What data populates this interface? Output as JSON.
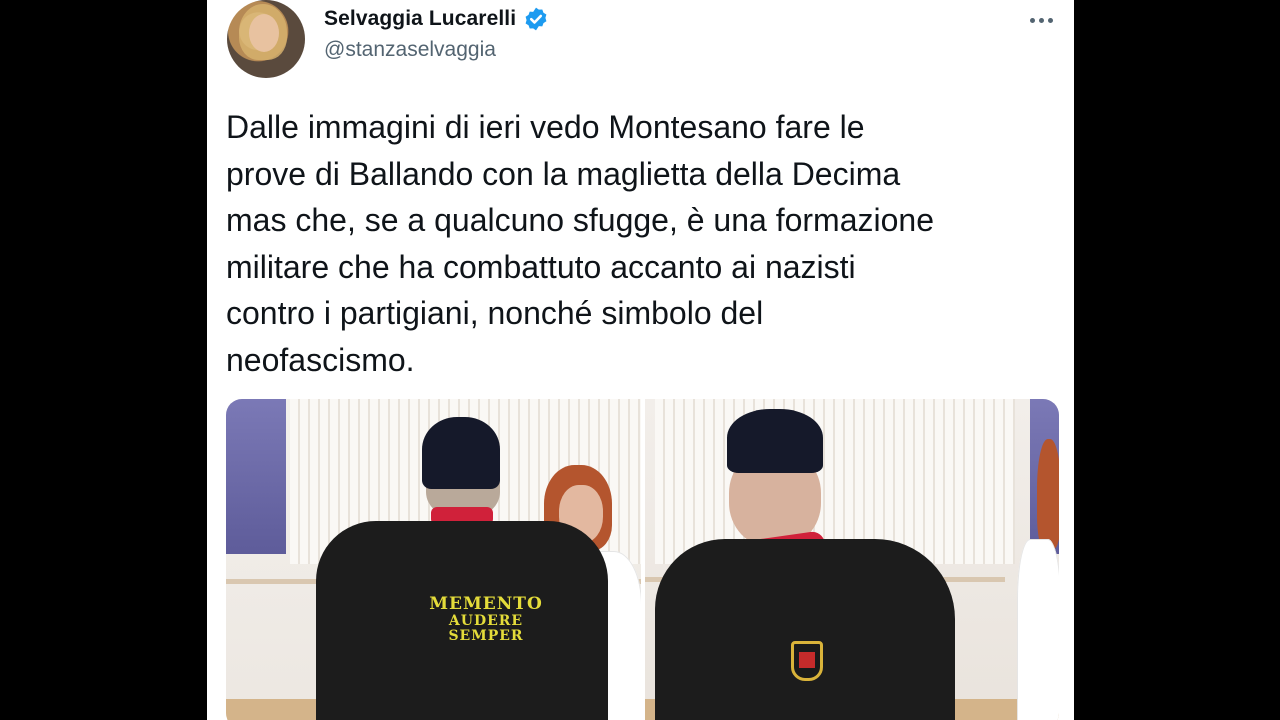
{
  "tweet": {
    "author": {
      "display_name": "Selvaggia Lucarelli",
      "handle": "@stanzaselvaggia",
      "verified": true
    },
    "text": "Dalle immagini di ieri vedo Montesano fare le\nprove di Ballando con la maglietta della Decima\nmas che, se a qualcuno sfugge, è una formazione\nmilitare che ha combattuto accanto ai nazisti\ncontro i partigiani, nonché simbolo del\nneofascismo.",
    "media": {
      "photo_left": {
        "shirt_print_line1": "MEMENTO",
        "shirt_print_line2": "AUDERE SEMPER"
      }
    }
  },
  "colors": {
    "background": "#000000",
    "card": "#ffffff",
    "text_primary": "#0f1419",
    "text_secondary": "#536471",
    "verified_blue": "#1d9bf0"
  }
}
